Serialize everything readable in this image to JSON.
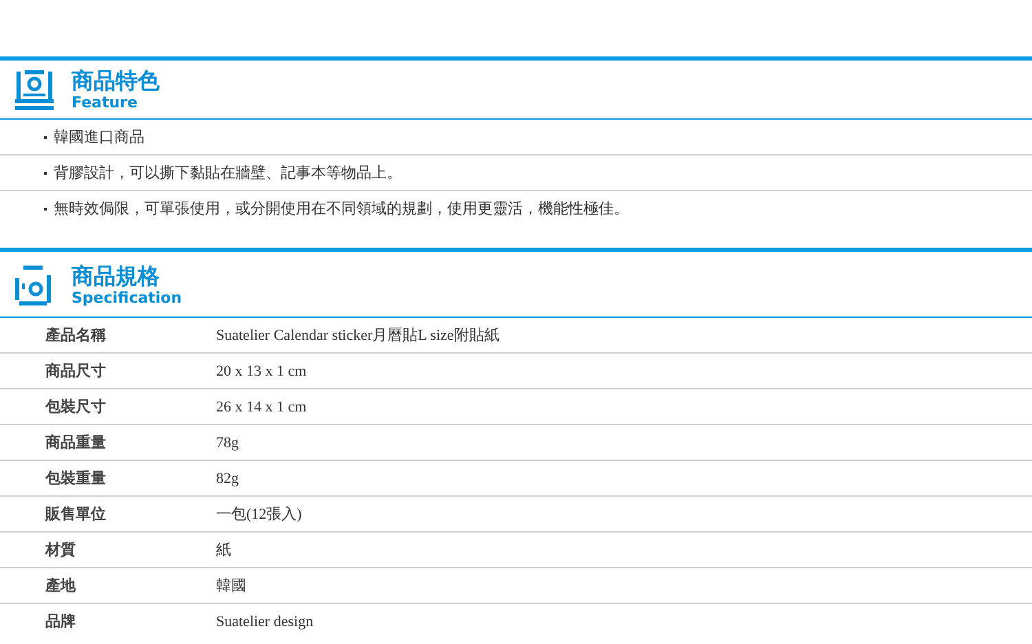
{
  "sections": [
    {
      "kind": "features",
      "title": "商品特色",
      "subtitle": "Feature",
      "items": [
        "韓國進口商品",
        "背膠設計，可以撕下黏貼在牆壁、記事本等物品上。",
        "無時效侷限，可單張使用，或分開使用在不同領域的規劃，使用更靈活，機能性極佳。"
      ]
    },
    {
      "kind": "specs",
      "title": "商品規格",
      "subtitle": "Specification",
      "rows": [
        {
          "label": "產品名稱",
          "value": "Suatelier Calendar sticker月曆貼L size附貼紙"
        },
        {
          "label": "商品尺寸",
          "value": "20 x 13 x 1 cm"
        },
        {
          "label": "包裝尺寸",
          "value": "26 x 14 x 1 cm"
        },
        {
          "label": "商品重量",
          "value": "78g"
        },
        {
          "label": "包裝重量",
          "value": "82g"
        },
        {
          "label": "販售單位",
          "value": "一包(12張入)"
        },
        {
          "label": "材質",
          "value": "紙"
        },
        {
          "label": "產地",
          "value": "韓國"
        },
        {
          "label": "品牌",
          "value": "Suatelier design"
        }
      ]
    }
  ]
}
